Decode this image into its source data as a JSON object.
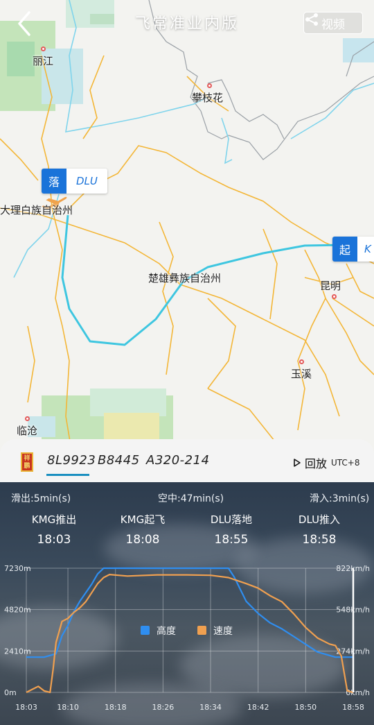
{
  "header": {
    "title": "飞常准业内版",
    "video_label": "视频"
  },
  "map": {
    "places": {
      "lijiang": "丽江",
      "panzhihua": "攀枝花",
      "dali": "大理白族自治州",
      "chuxiong": "楚雄彝族自治州",
      "kunming": "昆明",
      "yuxi": "玉溪",
      "lincang": "临沧"
    },
    "arrival_marker": {
      "tag": "落",
      "code": "DLU"
    },
    "departure_marker": {
      "tag": "起",
      "code": "K"
    },
    "route_color": "#3ec6e0"
  },
  "flight": {
    "seal_text": "祥鹏",
    "flight_no": "8L9923",
    "registration": "B8445",
    "aircraft": "A320-214",
    "replay_label": "回放",
    "timezone": "UTC+8"
  },
  "phases": {
    "taxi_out": "滑出:5min(s)",
    "airborne": "空中:47min(s)",
    "taxi_in": "滑入:3min(s)"
  },
  "events": [
    {
      "label": "KMG推出",
      "time": "18:03"
    },
    {
      "label": "KMG起飞",
      "time": "18:08"
    },
    {
      "label": "DLU落地",
      "time": "18:55"
    },
    {
      "label": "DLU推入",
      "time": "18:58"
    }
  ],
  "chart_data": {
    "type": "line",
    "x": [
      "18:03",
      "18:10",
      "18:18",
      "18:26",
      "18:34",
      "18:42",
      "18:50",
      "18:58"
    ],
    "xtick_labels": [
      "18:03",
      "18:10",
      "18:18",
      "18:26",
      "18:34",
      "18:42",
      "18:50",
      "18:58"
    ],
    "y_left_ticks": [
      "7230m",
      "4820m",
      "2410m",
      "0m"
    ],
    "y_right_ticks": [
      "822km/h",
      "548km/h",
      "274km/h",
      "0km/h"
    ],
    "ylim_left": [
      0,
      7230
    ],
    "ylim_right": [
      0,
      822
    ],
    "legend": [
      "高度",
      "速度"
    ],
    "series": [
      {
        "name": "高度",
        "color": "#2f8ef0",
        "axis": "left",
        "points": [
          [
            "18:03",
            2050
          ],
          [
            "18:06",
            2050
          ],
          [
            "18:08",
            2250
          ],
          [
            "18:09",
            3300
          ],
          [
            "18:10",
            3900
          ],
          [
            "18:11",
            4700
          ],
          [
            "18:12",
            5300
          ],
          [
            "18:13",
            5800
          ],
          [
            "18:14",
            6300
          ],
          [
            "18:15",
            6900
          ],
          [
            "18:16",
            7230
          ],
          [
            "18:37",
            7230
          ],
          [
            "18:38",
            6700
          ],
          [
            "18:40",
            5300
          ],
          [
            "18:42",
            4600
          ],
          [
            "18:44",
            4050
          ],
          [
            "18:46",
            3700
          ],
          [
            "18:48",
            3250
          ],
          [
            "18:50",
            2800
          ],
          [
            "18:52",
            2350
          ],
          [
            "18:55",
            2050
          ],
          [
            "18:58",
            2050
          ]
        ]
      },
      {
        "name": "速度",
        "color": "#f0a050",
        "axis": "right",
        "points": [
          [
            "18:03",
            0
          ],
          [
            "18:04",
            20
          ],
          [
            "18:05",
            40
          ],
          [
            "18:06",
            10
          ],
          [
            "18:07",
            0
          ],
          [
            "18:07.5",
            150
          ],
          [
            "18:08",
            330
          ],
          [
            "18:09",
            470
          ],
          [
            "18:10",
            490
          ],
          [
            "18:11",
            530
          ],
          [
            "18:12",
            560
          ],
          [
            "18:13",
            600
          ],
          [
            "18:14",
            660
          ],
          [
            "18:15",
            720
          ],
          [
            "18:16",
            760
          ],
          [
            "18:17",
            780
          ],
          [
            "18:20",
            770
          ],
          [
            "18:25",
            778
          ],
          [
            "18:30",
            778
          ],
          [
            "18:34",
            775
          ],
          [
            "18:37",
            760
          ],
          [
            "18:40",
            720
          ],
          [
            "18:42",
            690
          ],
          [
            "18:44",
            640
          ],
          [
            "18:46",
            600
          ],
          [
            "18:48",
            520
          ],
          [
            "18:50",
            430
          ],
          [
            "18:52",
            360
          ],
          [
            "18:54",
            320
          ],
          [
            "18:55",
            310
          ],
          [
            "18:56",
            240
          ],
          [
            "18:57",
            10
          ],
          [
            "18:58",
            0
          ]
        ]
      }
    ]
  }
}
